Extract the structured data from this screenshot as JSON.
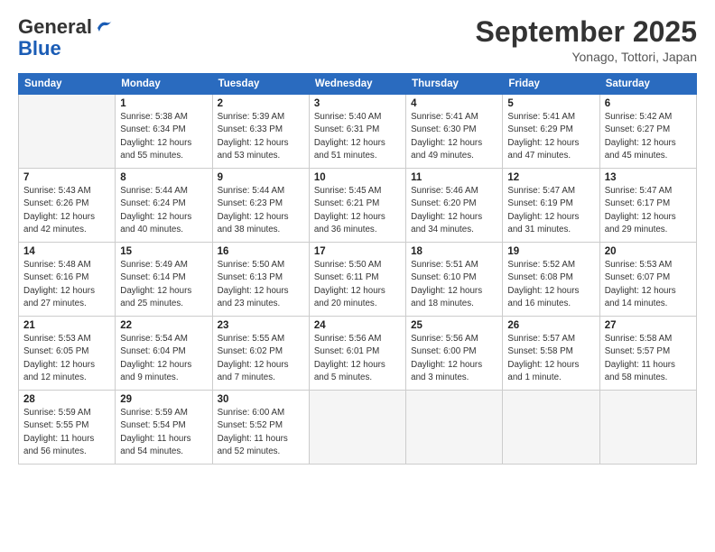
{
  "logo": {
    "text_general": "General",
    "text_blue": "Blue"
  },
  "header": {
    "month": "September 2025",
    "location": "Yonago, Tottori, Japan"
  },
  "days_of_week": [
    "Sunday",
    "Monday",
    "Tuesday",
    "Wednesday",
    "Thursday",
    "Friday",
    "Saturday"
  ],
  "weeks": [
    [
      {
        "day": "",
        "info": ""
      },
      {
        "day": "1",
        "info": "Sunrise: 5:38 AM\nSunset: 6:34 PM\nDaylight: 12 hours\nand 55 minutes."
      },
      {
        "day": "2",
        "info": "Sunrise: 5:39 AM\nSunset: 6:33 PM\nDaylight: 12 hours\nand 53 minutes."
      },
      {
        "day": "3",
        "info": "Sunrise: 5:40 AM\nSunset: 6:31 PM\nDaylight: 12 hours\nand 51 minutes."
      },
      {
        "day": "4",
        "info": "Sunrise: 5:41 AM\nSunset: 6:30 PM\nDaylight: 12 hours\nand 49 minutes."
      },
      {
        "day": "5",
        "info": "Sunrise: 5:41 AM\nSunset: 6:29 PM\nDaylight: 12 hours\nand 47 minutes."
      },
      {
        "day": "6",
        "info": "Sunrise: 5:42 AM\nSunset: 6:27 PM\nDaylight: 12 hours\nand 45 minutes."
      }
    ],
    [
      {
        "day": "7",
        "info": "Sunrise: 5:43 AM\nSunset: 6:26 PM\nDaylight: 12 hours\nand 42 minutes."
      },
      {
        "day": "8",
        "info": "Sunrise: 5:44 AM\nSunset: 6:24 PM\nDaylight: 12 hours\nand 40 minutes."
      },
      {
        "day": "9",
        "info": "Sunrise: 5:44 AM\nSunset: 6:23 PM\nDaylight: 12 hours\nand 38 minutes."
      },
      {
        "day": "10",
        "info": "Sunrise: 5:45 AM\nSunset: 6:21 PM\nDaylight: 12 hours\nand 36 minutes."
      },
      {
        "day": "11",
        "info": "Sunrise: 5:46 AM\nSunset: 6:20 PM\nDaylight: 12 hours\nand 34 minutes."
      },
      {
        "day": "12",
        "info": "Sunrise: 5:47 AM\nSunset: 6:19 PM\nDaylight: 12 hours\nand 31 minutes."
      },
      {
        "day": "13",
        "info": "Sunrise: 5:47 AM\nSunset: 6:17 PM\nDaylight: 12 hours\nand 29 minutes."
      }
    ],
    [
      {
        "day": "14",
        "info": "Sunrise: 5:48 AM\nSunset: 6:16 PM\nDaylight: 12 hours\nand 27 minutes."
      },
      {
        "day": "15",
        "info": "Sunrise: 5:49 AM\nSunset: 6:14 PM\nDaylight: 12 hours\nand 25 minutes."
      },
      {
        "day": "16",
        "info": "Sunrise: 5:50 AM\nSunset: 6:13 PM\nDaylight: 12 hours\nand 23 minutes."
      },
      {
        "day": "17",
        "info": "Sunrise: 5:50 AM\nSunset: 6:11 PM\nDaylight: 12 hours\nand 20 minutes."
      },
      {
        "day": "18",
        "info": "Sunrise: 5:51 AM\nSunset: 6:10 PM\nDaylight: 12 hours\nand 18 minutes."
      },
      {
        "day": "19",
        "info": "Sunrise: 5:52 AM\nSunset: 6:08 PM\nDaylight: 12 hours\nand 16 minutes."
      },
      {
        "day": "20",
        "info": "Sunrise: 5:53 AM\nSunset: 6:07 PM\nDaylight: 12 hours\nand 14 minutes."
      }
    ],
    [
      {
        "day": "21",
        "info": "Sunrise: 5:53 AM\nSunset: 6:05 PM\nDaylight: 12 hours\nand 12 minutes."
      },
      {
        "day": "22",
        "info": "Sunrise: 5:54 AM\nSunset: 6:04 PM\nDaylight: 12 hours\nand 9 minutes."
      },
      {
        "day": "23",
        "info": "Sunrise: 5:55 AM\nSunset: 6:02 PM\nDaylight: 12 hours\nand 7 minutes."
      },
      {
        "day": "24",
        "info": "Sunrise: 5:56 AM\nSunset: 6:01 PM\nDaylight: 12 hours\nand 5 minutes."
      },
      {
        "day": "25",
        "info": "Sunrise: 5:56 AM\nSunset: 6:00 PM\nDaylight: 12 hours\nand 3 minutes."
      },
      {
        "day": "26",
        "info": "Sunrise: 5:57 AM\nSunset: 5:58 PM\nDaylight: 12 hours\nand 1 minute."
      },
      {
        "day": "27",
        "info": "Sunrise: 5:58 AM\nSunset: 5:57 PM\nDaylight: 11 hours\nand 58 minutes."
      }
    ],
    [
      {
        "day": "28",
        "info": "Sunrise: 5:59 AM\nSunset: 5:55 PM\nDaylight: 11 hours\nand 56 minutes."
      },
      {
        "day": "29",
        "info": "Sunrise: 5:59 AM\nSunset: 5:54 PM\nDaylight: 11 hours\nand 54 minutes."
      },
      {
        "day": "30",
        "info": "Sunrise: 6:00 AM\nSunset: 5:52 PM\nDaylight: 11 hours\nand 52 minutes."
      },
      {
        "day": "",
        "info": ""
      },
      {
        "day": "",
        "info": ""
      },
      {
        "day": "",
        "info": ""
      },
      {
        "day": "",
        "info": ""
      }
    ]
  ]
}
